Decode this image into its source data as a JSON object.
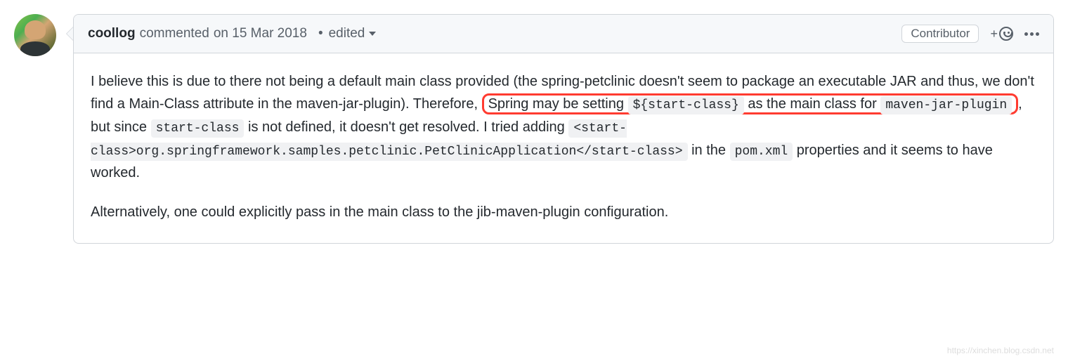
{
  "comment": {
    "author": "coollog",
    "action_text": "commented",
    "date": "on 15 Mar 2018",
    "edited_label": "edited",
    "badge": "Contributor",
    "body": {
      "p1_part1": "I believe this is due to there not being a default main class provided (the spring-petclinic doesn't seem to package an executable JAR and thus, we don't find a Main-Class attribute in the maven-jar-plugin). Therefore,",
      "highlight_text1": "Spring may be setting ",
      "highlight_code1": "${start-class}",
      "highlight_text2": " as the main class for ",
      "highlight_code2": "maven-jar-plugin",
      "p1_part2": ", but since ",
      "code_start_class": "start-class",
      "p1_part3": " is not defined, it doesn't get resolved. I tried adding ",
      "code_xml": "<start-class>org.springframework.samples.petclinic.PetClinicApplication</start-class>",
      "p1_part4": " in the ",
      "code_pom": "pom.xml",
      "p1_part5": " properties and it seems to have worked.",
      "p2": "Alternatively, one could explicitly pass in the main class to the jib-maven-plugin configuration."
    }
  },
  "watermark": "https://xinchen.blog.csdn.net"
}
